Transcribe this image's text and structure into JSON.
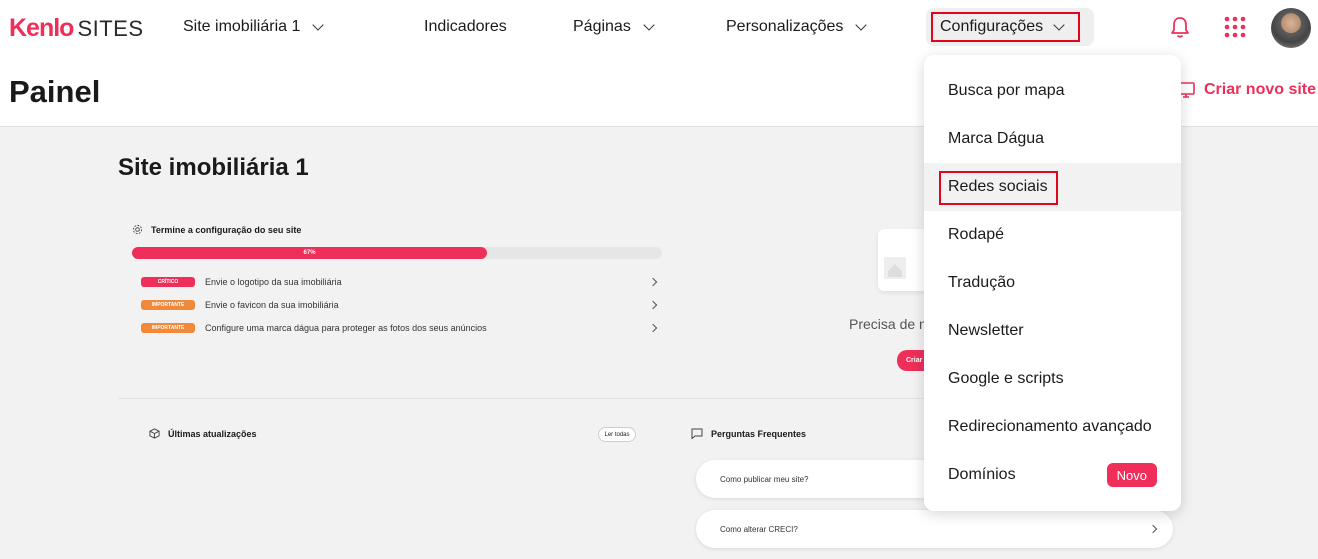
{
  "logo": {
    "brand": "Kenlo",
    "product": "SITES"
  },
  "nav": {
    "site_selector": "Site imobiliária 1",
    "indicadores": "Indicadores",
    "paginas": "Páginas",
    "personalizacoes": "Personalizações",
    "configuracoes": "Configurações"
  },
  "header": {
    "title": "Painel",
    "create_site": "Criar novo site"
  },
  "site": {
    "title": "Site imobiliária 1"
  },
  "setup": {
    "title": "Termine a configuração do seu site",
    "progress_label": "67%",
    "progress_fraction": 0.67,
    "tasks": [
      {
        "badge": "CRÍTICO",
        "text": "Envie o logotipo da sua imobiliária"
      },
      {
        "badge": "IMPORTANTE",
        "text": "Envie o favicon da sua imobiliária"
      },
      {
        "badge": "IMPORTANTE",
        "text": "Configure uma marca dágua para proteger as fotos dos seus anúncios"
      }
    ]
  },
  "empty_state": {
    "text": "Precisa de n",
    "button": "Criar"
  },
  "updates": {
    "title": "Últimas atualizações",
    "read_all": "Ler todas"
  },
  "faq": {
    "title": "Perguntas Frequentes",
    "items": [
      "Como publicar meu site?",
      "Como alterar CRECI?"
    ]
  },
  "dropdown": {
    "items": [
      "Busca por mapa",
      "Marca Dágua",
      "Redes sociais",
      "Rodapé",
      "Tradução",
      "Newsletter",
      "Google e scripts",
      "Redirecionamento avançado",
      "Domínios"
    ],
    "novo_badge": "Novo"
  },
  "colors": {
    "accent": "#ef2f5a",
    "highlight": "#e0061b",
    "warning": "#f08a3a"
  },
  "icons": [
    "bell-icon",
    "apps-grid-icon",
    "avatar",
    "monitor-icon",
    "gear-icon",
    "box-icon",
    "chat-icon",
    "chevron-down-icon",
    "chevron-right-icon"
  ]
}
